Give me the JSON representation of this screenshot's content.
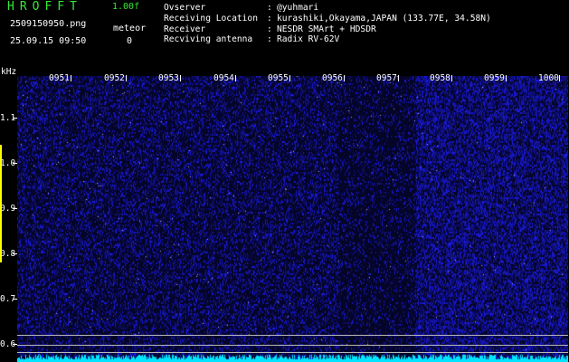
{
  "header": {
    "app_title": "HROFFT",
    "version": "1.00f",
    "file_name": "2509150950.png",
    "date_time": "25.09.15 09:50",
    "meteor_label": "meteor",
    "meteor_count": "0"
  },
  "info": [
    {
      "key": "Ovserver",
      "value": "@yuhmari"
    },
    {
      "key": "Receiving Location",
      "value": "kurashiki,Okayama,JAPAN (133.77E, 34.58N)"
    },
    {
      "key": "Receiver",
      "value": "NESDR SMArt + HDSDR"
    },
    {
      "key": "Recviving antenna",
      "value": "Radix RV-62V"
    }
  ],
  "spectrogram": {
    "unit": "kHz",
    "y_labels": [
      "1.1",
      "1.0",
      "0.9",
      "0.8",
      "0.7",
      "0.6"
    ],
    "time_labels": [
      "0951",
      "0952",
      "0953",
      "0954",
      "0955",
      "0956",
      "0957",
      "0958",
      "0959",
      "1000"
    ],
    "colors": {
      "background": "#050528",
      "noise": "#2020c8",
      "accent": "#35e935",
      "trace": "#00e5ff"
    }
  }
}
